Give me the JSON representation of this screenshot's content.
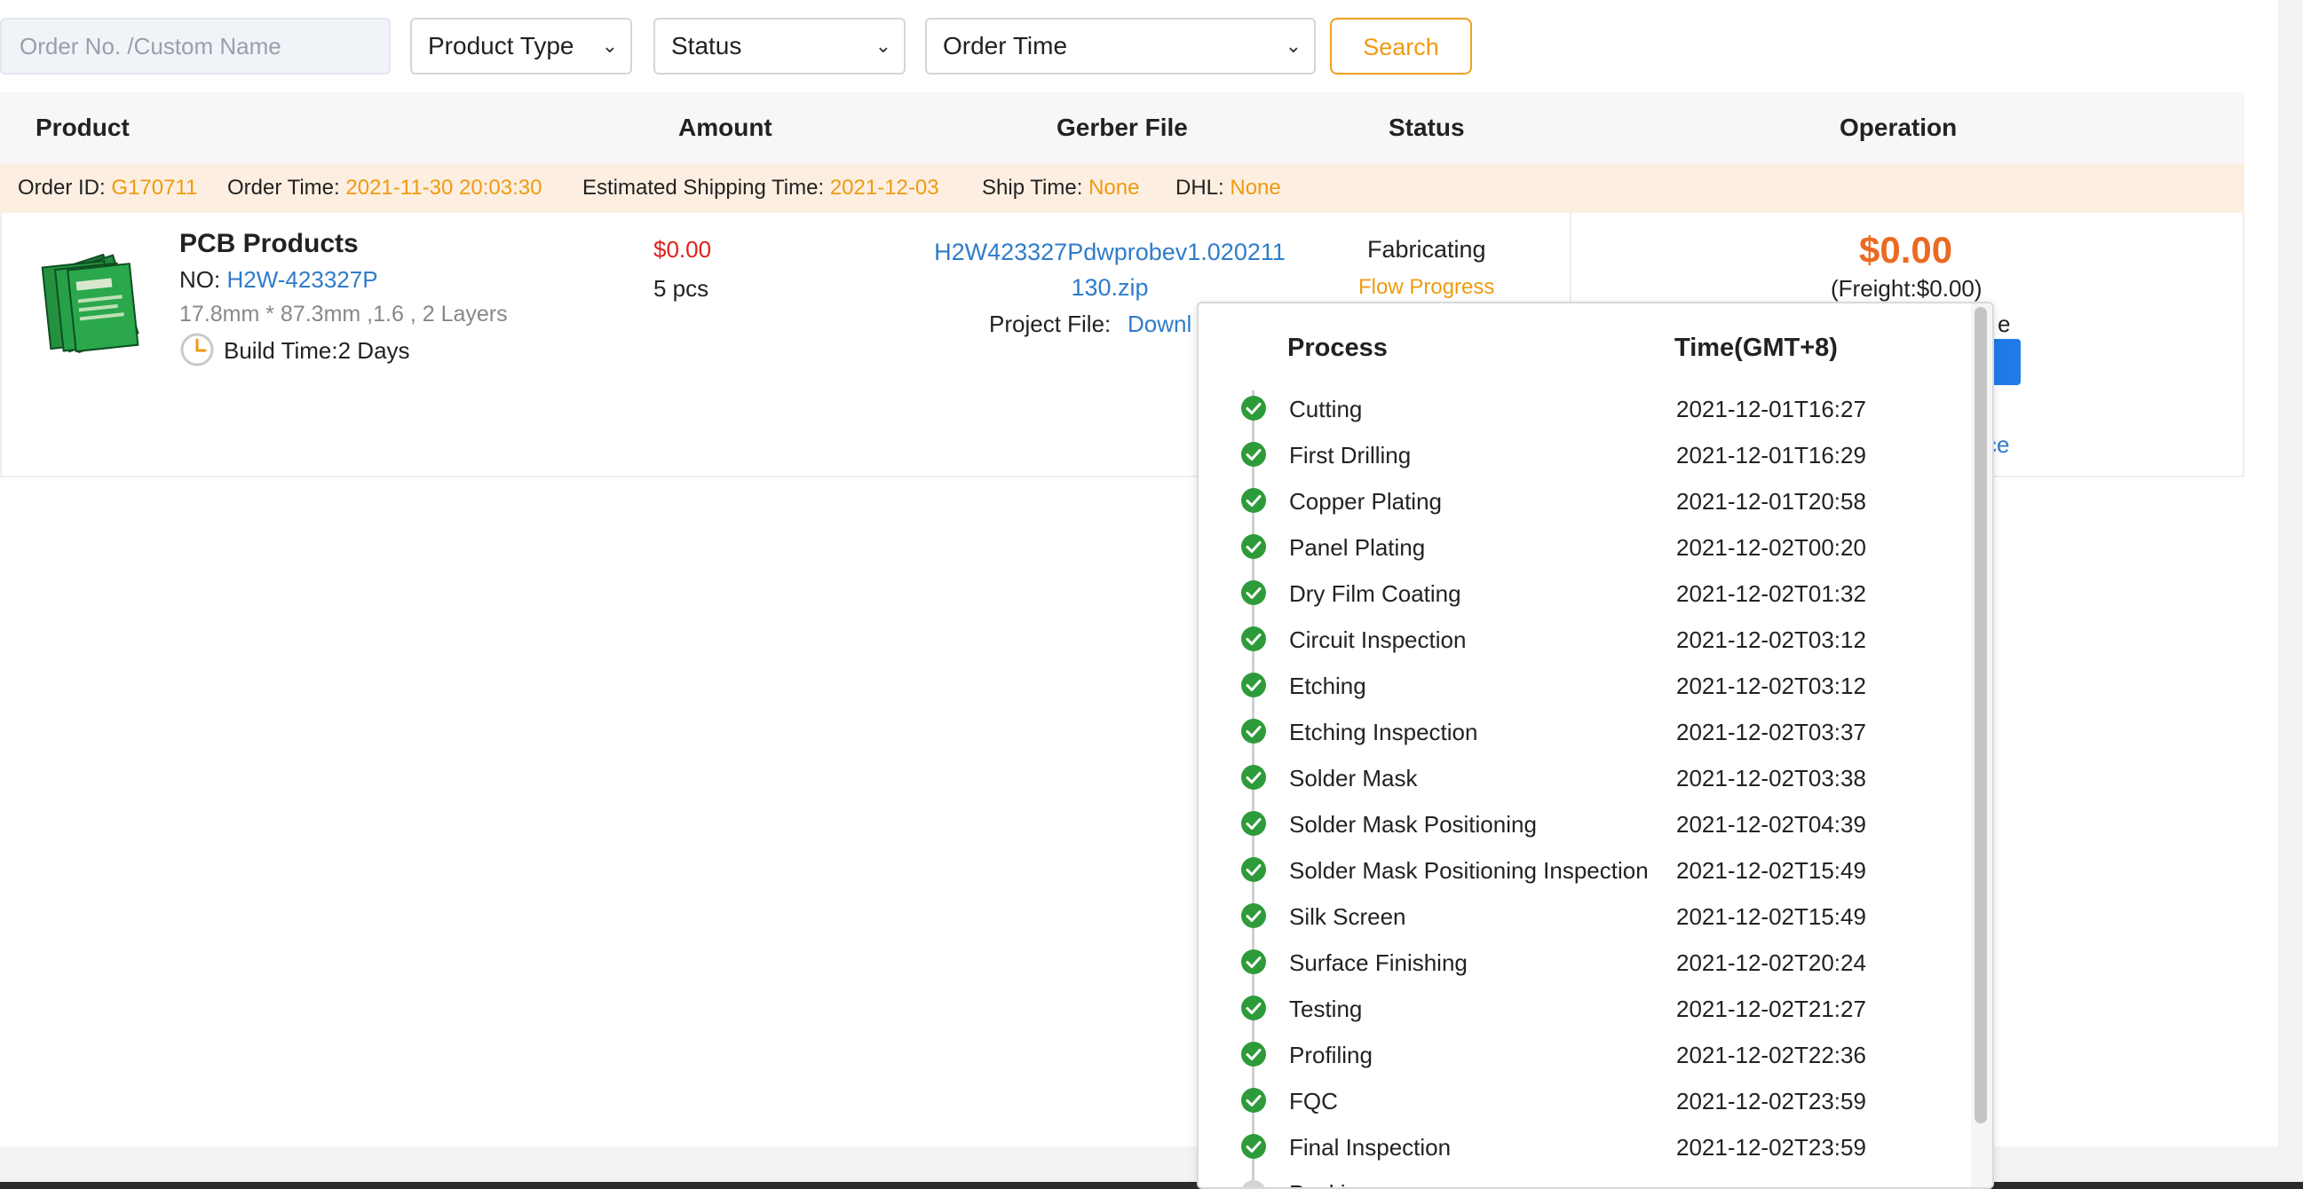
{
  "filters": {
    "order_placeholder": "Order No. /Custom Name",
    "product_type": "Product Type",
    "status": "Status",
    "order_time": "Order Time",
    "search_label": "Search"
  },
  "table_headers": {
    "product": "Product",
    "amount": "Amount",
    "gerber": "Gerber File",
    "status": "Status",
    "operation": "Operation"
  },
  "order": {
    "id_label": "Order ID:",
    "id": "G170711",
    "time_label": "Order Time:",
    "time": "2021-11-30 20:03:30",
    "est_ship_label": "Estimated Shipping Time:",
    "est_ship": "2021-12-03",
    "ship_time_label": "Ship Time:",
    "ship_time": "None",
    "dhl_label": "DHL:",
    "dhl": "None",
    "product_title": "PCB Products",
    "no_label": "NO:",
    "no": "H2W-423327P",
    "spec": "17.8mm * 87.3mm ,1.6 , 2 Layers",
    "build_time": "Build Time:2 Days",
    "amount": "$0.00",
    "quantity": "5 pcs",
    "gerber_file": "H2W423327Pdwprobev1.020211130.zip",
    "project_file_label": "Project File:",
    "project_file_link": "Downl",
    "status": "Fabricating",
    "flow_progress": "Flow Progress",
    "price": "$0.00",
    "freight": "(Freight:$0.00)",
    "op_partial_text": "e",
    "op_partial_link": "ce"
  },
  "flow": {
    "header_process": "Process",
    "header_time": "Time(GMT+8)",
    "steps": [
      {
        "name": "Cutting",
        "time": "2021-12-01T16:27",
        "done": true
      },
      {
        "name": "First Drilling",
        "time": "2021-12-01T16:29",
        "done": true
      },
      {
        "name": "Copper Plating",
        "time": "2021-12-01T20:58",
        "done": true
      },
      {
        "name": "Panel Plating",
        "time": "2021-12-02T00:20",
        "done": true
      },
      {
        "name": "Dry Film Coating",
        "time": "2021-12-02T01:32",
        "done": true
      },
      {
        "name": "Circuit Inspection",
        "time": "2021-12-02T03:12",
        "done": true
      },
      {
        "name": "Etching",
        "time": "2021-12-02T03:12",
        "done": true
      },
      {
        "name": "Etching Inspection",
        "time": "2021-12-02T03:37",
        "done": true
      },
      {
        "name": "Solder Mask",
        "time": "2021-12-02T03:38",
        "done": true
      },
      {
        "name": "Solder Mask Positioning",
        "time": "2021-12-02T04:39",
        "done": true
      },
      {
        "name": "Solder Mask Positioning Inspection",
        "time": "2021-12-02T15:49",
        "done": true
      },
      {
        "name": "Silk Screen",
        "time": "2021-12-02T15:49",
        "done": true
      },
      {
        "name": "Surface Finishing",
        "time": "2021-12-02T20:24",
        "done": true
      },
      {
        "name": "Testing",
        "time": "2021-12-02T21:27",
        "done": true
      },
      {
        "name": "Profiling",
        "time": "2021-12-02T22:36",
        "done": true
      },
      {
        "name": "FQC",
        "time": "2021-12-02T23:59",
        "done": true
      },
      {
        "name": "Final Inspection",
        "time": "2021-12-02T23:59",
        "done": true
      },
      {
        "name": "Packing",
        "time": "",
        "done": false
      }
    ]
  },
  "colors": {
    "accent_orange": "#ef9a10",
    "price_orange": "#ea6a22",
    "link_blue": "#2f7cc9",
    "amount_red": "#e0201a",
    "done_green": "#2e9b3a",
    "pending_gray": "#d4d4d4",
    "order_bar_bg": "#fcefe1",
    "primary_button": "#1e7be8"
  },
  "icons": {
    "step_done": "check-circle-icon",
    "step_pending": "circle-icon",
    "build_time": "clock-icon",
    "select_arrow": "chevron-down-icon"
  }
}
